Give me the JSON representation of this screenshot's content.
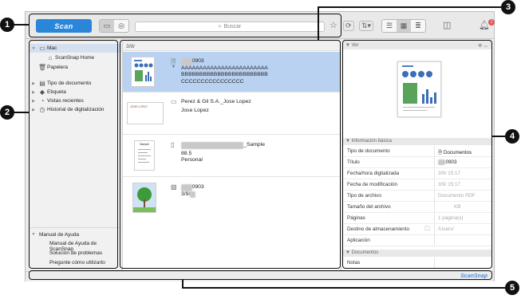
{
  "callouts": [
    "1",
    "2",
    "3",
    "4",
    "5"
  ],
  "toolbar": {
    "scan_label": "Scan",
    "search_placeholder": "Buscar",
    "bell_badge": "1"
  },
  "sidebar": {
    "items": [
      {
        "label": "Mac"
      },
      {
        "label": "ScanSnap Home"
      },
      {
        "label": "Papelera"
      },
      {
        "label": "Tipo de documento"
      },
      {
        "label": "Etiqueta"
      },
      {
        "label": "Vistas recientes"
      },
      {
        "label": "Historial de digitalización"
      }
    ],
    "help": {
      "title": "Manual de Ayuda",
      "links": [
        "Manual de Ayuda de ScanSnap",
        "Solución de problemas",
        "Pregunte cómo utilizarlo"
      ]
    }
  },
  "list": {
    "header": "3/9/",
    "rows": [
      {
        "title_suffix": "0903",
        "line2": "AAAAAAAAAAAAAAAAAAAAAAAA",
        "line3": "BBBBBBBBBBBBBBBBBBBBBBBB",
        "line4": "CCCCCCCCCCCCCCCC"
      },
      {
        "title": "Perez & Gil S.A._Jose Lopez",
        "line2": "Jose Lopez",
        "thumb_text": "JOSE LOPEZ"
      },
      {
        "title_suffix": "_Sample",
        "line2": "88.5",
        "line3": "Personal",
        "thumb_text": "Sample"
      },
      {
        "title_suffix": "0903",
        "line2": "3/9/"
      }
    ]
  },
  "details": {
    "view_label": "Ver",
    "basic_info_label": "Información básica",
    "properties": [
      {
        "key": "Tipo de documento",
        "value": "Documentos"
      },
      {
        "key": "Título",
        "value": "0903"
      },
      {
        "key": "Fecha/hora digitalizada",
        "value": "3/9/ 15:17"
      },
      {
        "key": "Fecha de modificación",
        "value": "3/9/ 15:17"
      },
      {
        "key": "Tipo de archivo",
        "value": "Documento PDF"
      },
      {
        "key": "Tamaño del archivo",
        "value": "KB"
      },
      {
        "key": "Páginas",
        "value": "1 página(s)"
      },
      {
        "key": "Destino de almacenamiento",
        "value": "/Users/"
      },
      {
        "key": "Aplicación",
        "value": ""
      }
    ],
    "documents_section_label": "Documentos",
    "notes_label": "Notas"
  },
  "statusbar": {
    "brand": "ScanSnap"
  },
  "colors": {
    "accent": "#2a86d9",
    "selection": "#b9d2f1",
    "badge": "#e25555"
  }
}
